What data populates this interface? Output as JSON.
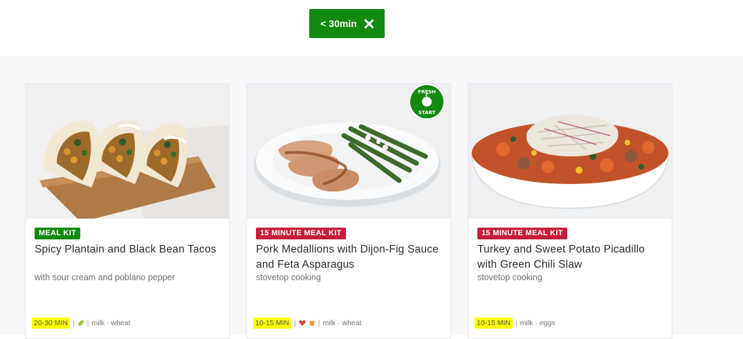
{
  "filter": {
    "label": "< 30min",
    "icon": "close-icon"
  },
  "cards": [
    {
      "tag": "MEAL KIT",
      "tag_color": "#128a12",
      "title": "Spicy Plantain and Black Bean Tacos",
      "subtitle": "with sour cream and poblano pepper",
      "time": "20-30 MIN",
      "allergens": "milk · wheat",
      "icons": [
        "leaf-icon"
      ]
    },
    {
      "tag": "15 MINUTE MEAL KIT",
      "tag_color": "#c41e3a",
      "title": "Pork Medallions with Dijon-Fig Sauce and Feta Asparagus",
      "subtitle": "stovetop cooking",
      "time": "10-15 MIN",
      "allergens": "milk · wheat",
      "icons": [
        "heart-icon",
        "carb-icon"
      ],
      "badge": {
        "line1": "FRESH",
        "line2": "START"
      }
    },
    {
      "tag": "15 MINUTE MEAL KIT",
      "tag_color": "#c41e3a",
      "title": "Turkey and Sweet Potato Picadillo with Green Chili Slaw",
      "subtitle": "stovetop cooking",
      "time": "10-15 MIN",
      "allergens": "milk · eggs",
      "icons": []
    }
  ]
}
